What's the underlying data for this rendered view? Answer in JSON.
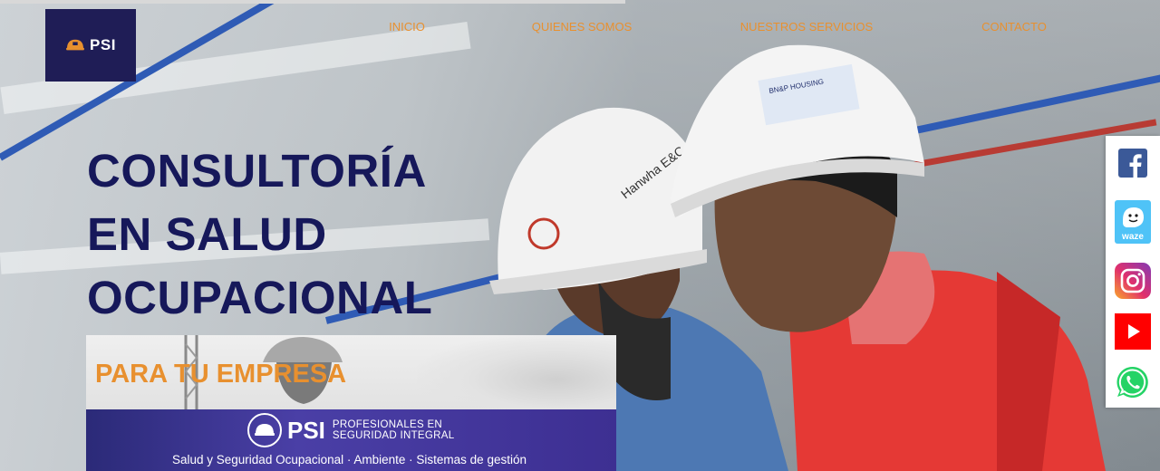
{
  "brand": {
    "logo_text": "PSI"
  },
  "nav": {
    "items": [
      {
        "label": "INICIO"
      },
      {
        "label": "QUIENES SOMOS"
      },
      {
        "label": "NUESTROS SERVICIOS"
      },
      {
        "label": "CONTACTO"
      }
    ]
  },
  "hero": {
    "headline_line1": "CONSULTORÍA",
    "headline_line2": "EN SALUD",
    "headline_line3": "OCUPACIONAL",
    "helmet_left_text": "Hanwha E&C",
    "helmet_right_text": "BN&P HOUSING"
  },
  "promo": {
    "title": "PARA TU EMPRESA",
    "brand": "PSI",
    "tagline_line1": "PROFESIONALES EN",
    "tagline_line2": "SEGURIDAD INTEGRAL",
    "services": "Salud y Seguridad Ocupacional · Ambiente · Sistemas de gestión"
  },
  "social": {
    "waze_label": "waze",
    "icons": [
      "facebook-icon",
      "waze-icon",
      "instagram-icon",
      "youtube-icon",
      "whatsapp-icon"
    ]
  },
  "colors": {
    "accent_orange": "#e8902f",
    "headline_navy": "#16185a",
    "logo_bg": "#1f1d56",
    "facebook": "#3b5998",
    "waze": "#4fc3f7",
    "youtube": "#ff0000",
    "whatsapp": "#25d366"
  }
}
